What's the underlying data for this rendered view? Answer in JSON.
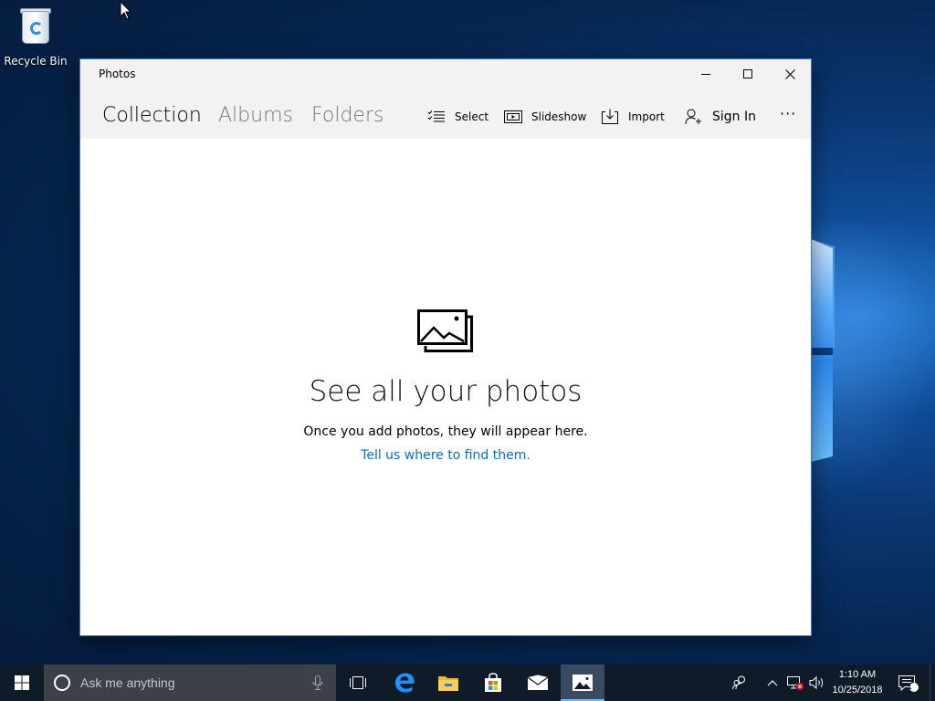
{
  "desktop": {
    "icons": [
      {
        "label": "Recycle Bin",
        "icon": "recycle-bin-icon"
      }
    ]
  },
  "window": {
    "title": "Photos",
    "controls": {
      "minimize": "minimize-icon",
      "maximize": "maximize-icon",
      "close": "close-icon"
    },
    "tabs": [
      {
        "label": "Collection",
        "active": true
      },
      {
        "label": "Albums",
        "active": false
      },
      {
        "label": "Folders",
        "active": false
      }
    ],
    "commands": {
      "select": "Select",
      "slideshow": "Slideshow",
      "import": "Import",
      "sign_in": "Sign In",
      "more": "···"
    },
    "empty_state": {
      "icon": "photos-stack-icon",
      "title": "See all your photos",
      "subtitle": "Once you add photos, they will appear here.",
      "link": "Tell us where to find them."
    }
  },
  "taskbar": {
    "search_placeholder": "Ask me anything",
    "pinned": [
      "task-view-icon",
      "edge-icon",
      "file-explorer-icon",
      "store-icon",
      "mail-icon",
      "photos-icon"
    ],
    "active_app": "photos-icon",
    "tray": {
      "time": "1:10 AM",
      "date": "10/25/2018",
      "notifications_count": "1"
    }
  },
  "colors": {
    "accent": "#0a6ec5",
    "taskbar": "#101b2a",
    "window_border": "#3a78c3"
  }
}
